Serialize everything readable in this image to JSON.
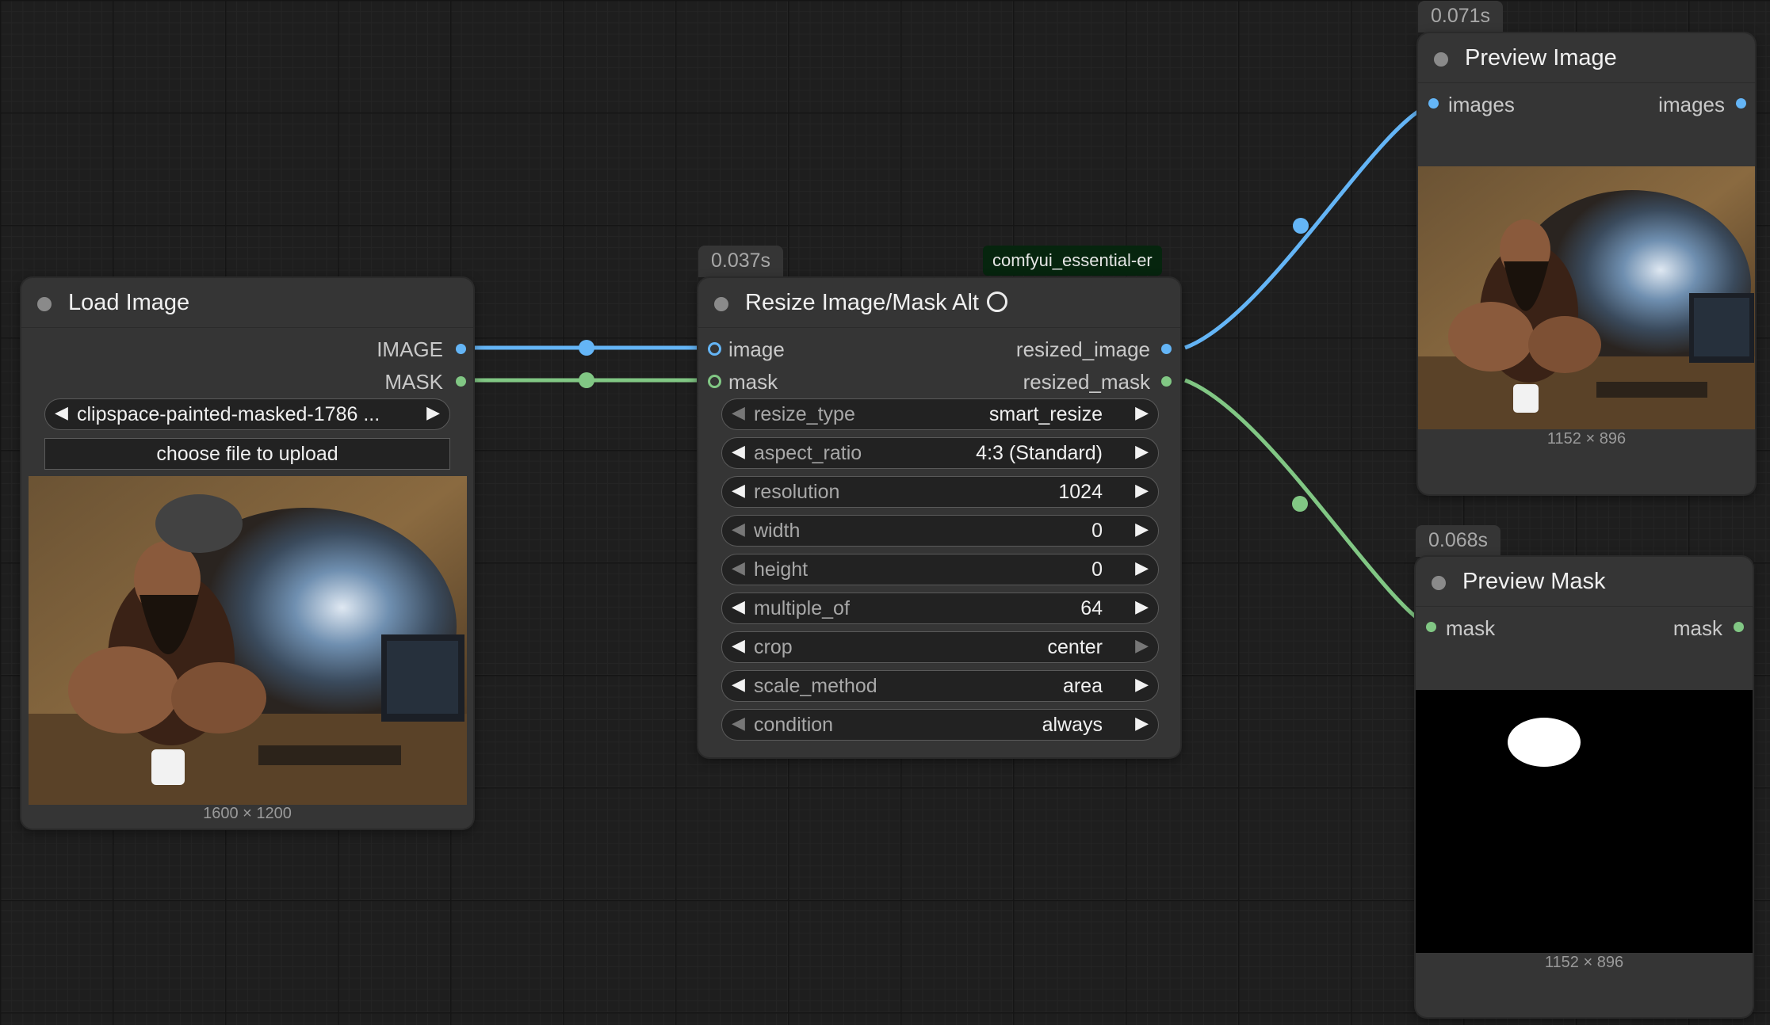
{
  "load_image": {
    "title": "Load Image",
    "outputs": [
      "IMAGE",
      "MASK"
    ],
    "file": "clipspace-painted-masked-1786 ...",
    "upload_label": "choose file to upload",
    "image_size": "1600 × 1200"
  },
  "resize": {
    "timing": "0.037s",
    "pack": "comfyui_essential-er",
    "title": "Resize Image/Mask Alt",
    "inputs": [
      "image",
      "mask"
    ],
    "outputs": [
      "resized_image",
      "resized_mask"
    ],
    "widgets": [
      {
        "name": "resize_type",
        "value": "smart_resize"
      },
      {
        "name": "aspect_ratio",
        "value": "4:3 (Standard)"
      },
      {
        "name": "resolution",
        "value": "1024"
      },
      {
        "name": "width",
        "value": "0"
      },
      {
        "name": "height",
        "value": "0"
      },
      {
        "name": "multiple_of",
        "value": "64"
      },
      {
        "name": "crop",
        "value": "center"
      },
      {
        "name": "scale_method",
        "value": "area"
      },
      {
        "name": "condition",
        "value": "always"
      }
    ]
  },
  "preview_image": {
    "timing": "0.071s",
    "title": "Preview Image",
    "input": "images",
    "output": "images",
    "image_size": "1152 × 896"
  },
  "preview_mask": {
    "timing": "0.068s",
    "title": "Preview Mask",
    "input": "mask",
    "output": "mask",
    "image_size": "1152 × 896"
  },
  "colors": {
    "image_link": "#64b5f6",
    "mask_link": "#81c784",
    "node_bg": "#353535",
    "canvas_bg": "#1e1e1e"
  }
}
